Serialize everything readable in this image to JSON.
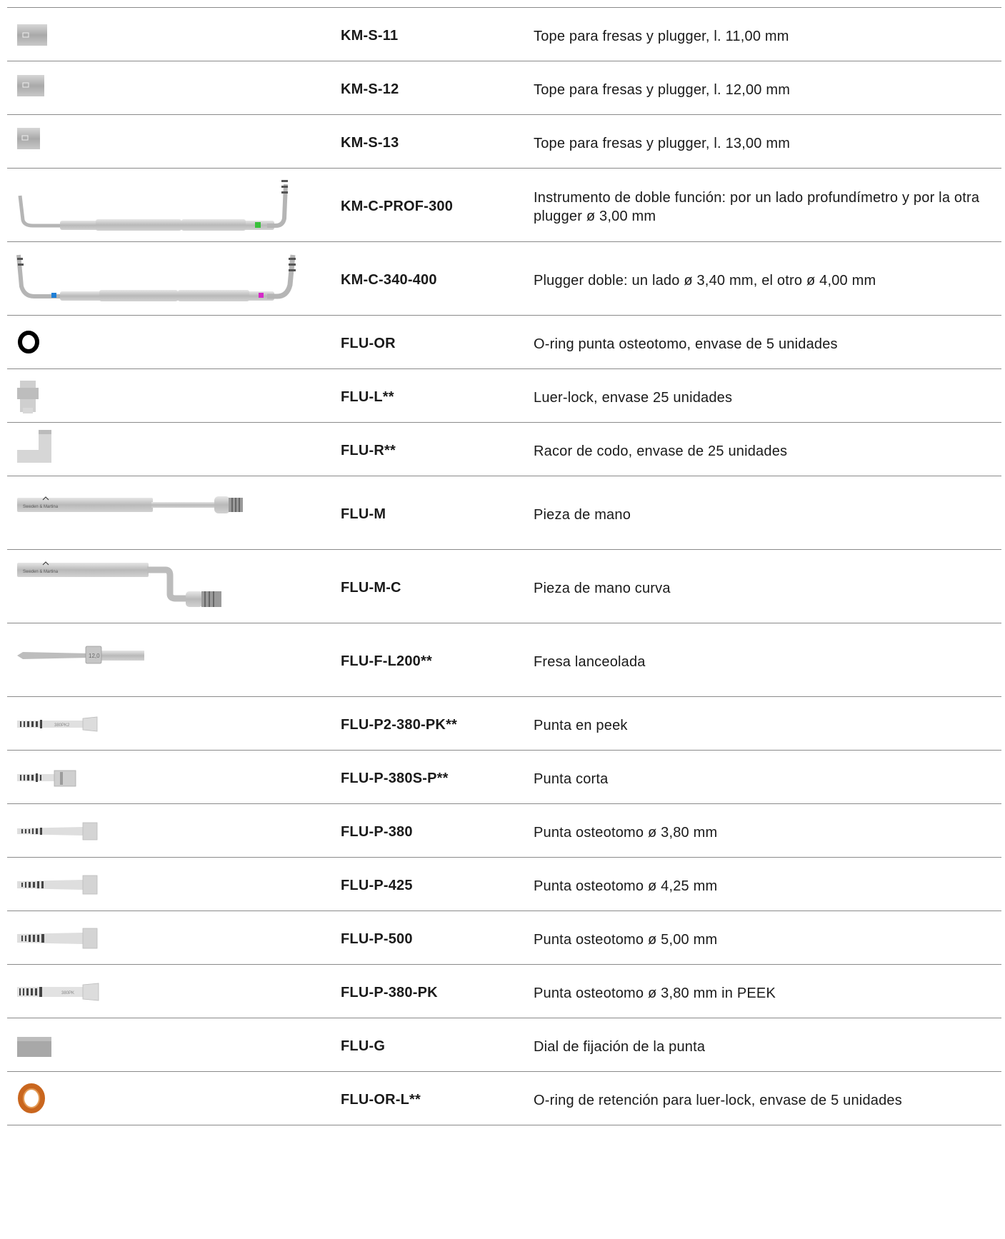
{
  "rows": [
    {
      "code": "KM-S-11",
      "description": "Tope para fresas y plugger, l. 11,00 mm",
      "image": "stop-11-icon"
    },
    {
      "code": "KM-S-12",
      "description": "Tope para fresas y plugger, l. 12,00 mm",
      "image": "stop-12-icon"
    },
    {
      "code": "KM-S-13",
      "description": "Tope para fresas y plugger, l. 13,00 mm",
      "image": "stop-13-icon"
    },
    {
      "code": "KM-C-PROF-300",
      "description": "Instrumento de doble función: por un lado profundímetro y por la otra plugger ø 3,00 mm",
      "image": "depth-gauge-plugger-icon",
      "accent": "#39c13b"
    },
    {
      "code": "KM-C-340-400",
      "description": "Plugger doble: un lado ø 3,40 mm, el otro ø 4,00 mm",
      "image": "double-plugger-icon",
      "accent": [
        "#1f7fd6",
        "#d52bc8"
      ]
    },
    {
      "code": "FLU-OR",
      "description": "O-ring punta osteotomo, envase de 5 unidades",
      "image": "o-ring-black-icon",
      "accent": "#000000"
    },
    {
      "code": "FLU-L**",
      "description": "Luer-lock, envase 25 unidades",
      "image": "luer-lock-icon"
    },
    {
      "code": "FLU-R**",
      "description": "Racor de codo, envase de 25 unidades",
      "image": "elbow-fitting-icon"
    },
    {
      "code": "FLU-M",
      "description": "Pieza de mano",
      "image": "handpiece-straight-icon"
    },
    {
      "code": "FLU-M-C",
      "description": "Pieza de mano curva",
      "image": "handpiece-curved-icon"
    },
    {
      "code": "FLU-F-L200**",
      "description": "Fresa lanceolada",
      "image": "lanceolate-drill-icon"
    },
    {
      "code": "FLU-P2-380-PK**",
      "description": "Punta en peek",
      "image": "peek-tip-icon"
    },
    {
      "code": "FLU-P-380S-P**",
      "description": "Punta corta",
      "image": "short-tip-icon"
    },
    {
      "code": "FLU-P-380",
      "description": "Punta osteotomo ø 3,80 mm",
      "image": "osteotome-tip-380-icon"
    },
    {
      "code": "FLU-P-425",
      "description": "Punta osteotomo ø 4,25 mm",
      "image": "osteotome-tip-425-icon"
    },
    {
      "code": "FLU-P-500",
      "description": "Punta osteotomo ø 5,00 mm",
      "image": "osteotome-tip-500-icon"
    },
    {
      "code": "FLU-P-380-PK",
      "description": "Punta osteotomo ø 3,80 mm in PEEK",
      "image": "osteotome-tip-peek-icon"
    },
    {
      "code": "FLU-G",
      "description": "Dial de fijación de la punta",
      "image": "fixing-dial-icon"
    },
    {
      "code": "FLU-OR-L**",
      "description": "O-ring de retención para luer-lock, envase de 5 unidades",
      "image": "o-ring-orange-icon",
      "accent": "#c9661e"
    }
  ],
  "image_text": {
    "peek_tip_label": "380PK2",
    "tip_peek_label": "380PK",
    "drill_label": "12,0",
    "handpiece_brand": "Sweden & Martina"
  }
}
